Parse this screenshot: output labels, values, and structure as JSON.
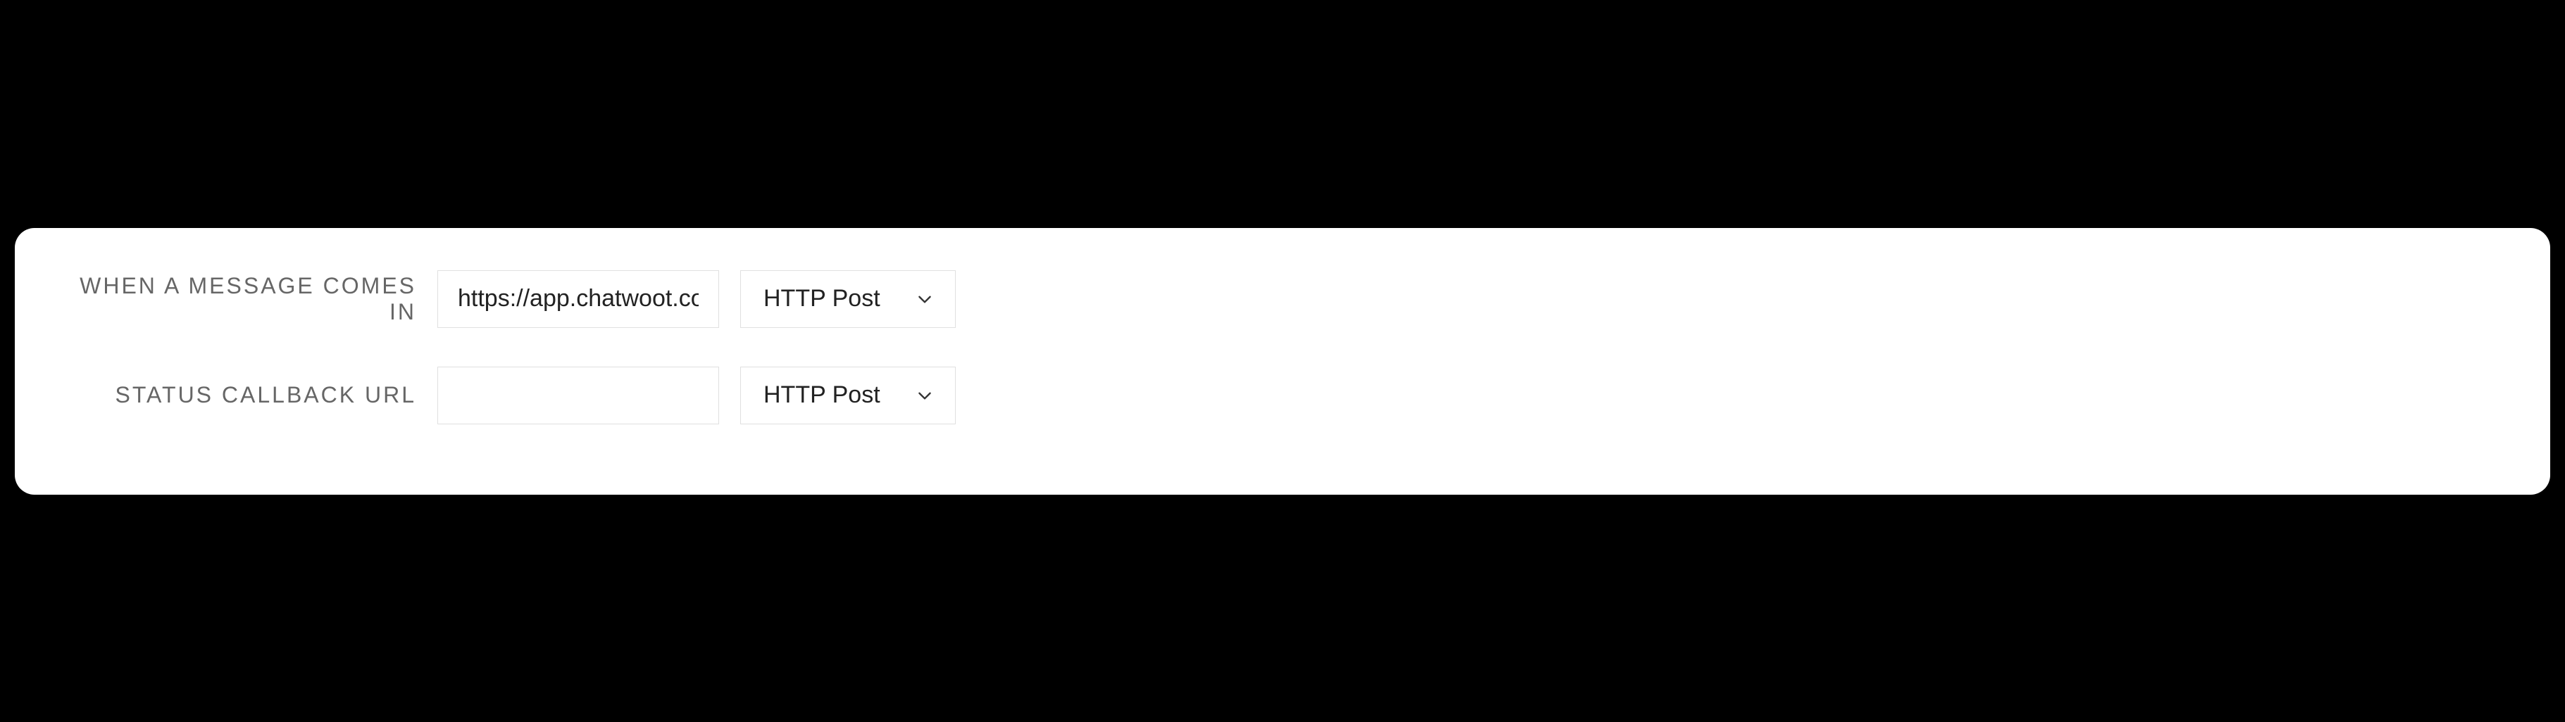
{
  "rows": [
    {
      "label": "WHEN A MESSAGE COMES IN",
      "input_value": "https://app.chatwoot.co",
      "select_value": "HTTP Post"
    },
    {
      "label": "STATUS CALLBACK URL",
      "input_value": "",
      "select_value": "HTTP Post"
    }
  ]
}
